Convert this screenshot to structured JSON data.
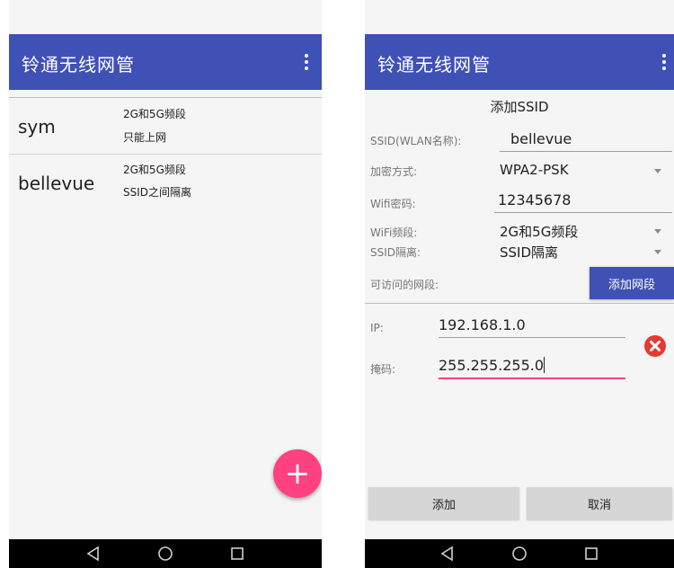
{
  "left_screen": {
    "app_title": "铃通无线网管",
    "ssid_list": [
      {
        "name": "sym",
        "band": "2G和5G频段",
        "mode": "只能上网"
      },
      {
        "name": "bellevue",
        "band": "2G和5G频段",
        "mode": "SSID之间隔离"
      }
    ],
    "fab_label": "+"
  },
  "right_screen": {
    "app_title": "铃通无线网管",
    "form_title": "添加SSID",
    "fields": {
      "ssid_label": "SSID(WLAN名称):",
      "ssid_value": "bellevue",
      "encryption_label": "加密方式:",
      "encryption_value": "WPA2-PSK",
      "password_label": "Wifi密码:",
      "password_value": "12345678",
      "band_label": "WiFi频段:",
      "band_value": "2G和5G频段",
      "isolation_label": "SSID隔离:",
      "isolation_value": "SSID隔离",
      "segments_label": "可访问的网段:"
    },
    "add_segment_button": "添加网段",
    "segment": {
      "ip_label": "IP:",
      "ip_value": "192.168.1.0",
      "mask_label": "掩码:",
      "mask_value": "255.255.255.0"
    },
    "add_button": "添加",
    "cancel_button": "取消"
  },
  "colors": {
    "app_bar": "#3f51b5",
    "fab": "#ff4081",
    "remove_icon": "#e53935",
    "focused_underline": "#ff4081",
    "nav_bar": "#000000"
  },
  "icons": {
    "overflow": "more-vert-icon",
    "add": "plus-icon",
    "remove": "close-circle-icon",
    "nav_back": "triangle-back-icon",
    "nav_home": "circle-home-icon",
    "nav_recent": "square-recent-icon"
  }
}
